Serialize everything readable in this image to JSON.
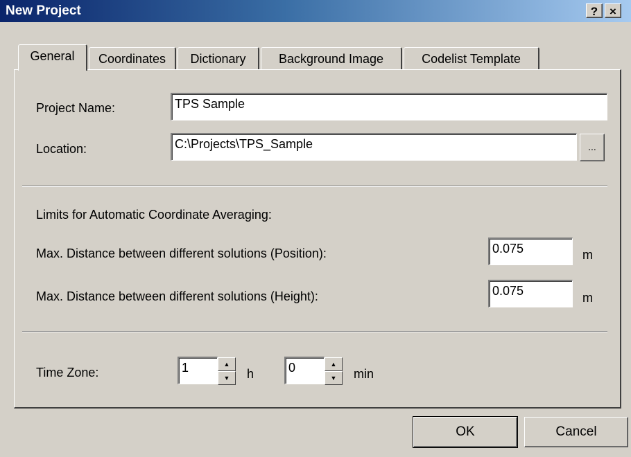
{
  "window": {
    "title": "New Project",
    "help_label": "?",
    "close_label": "×"
  },
  "tabs": [
    {
      "label": "General",
      "active": true
    },
    {
      "label": "Coordinates"
    },
    {
      "label": "Dictionary"
    },
    {
      "label": "Background Image"
    },
    {
      "label": "Codelist Template"
    }
  ],
  "general": {
    "project_name_label": "Project Name:",
    "project_name_value": "TPS Sample",
    "location_label": "Location:",
    "location_value": "C:\\Projects\\TPS_Sample",
    "browse_label": "...",
    "limits_heading": "Limits for Automatic Coordinate Averaging:",
    "max_position_label": "Max. Distance between different solutions (Position):",
    "max_position_value": "0.075",
    "max_position_unit": "m",
    "max_height_label": "Max. Distance between different solutions (Height):",
    "max_height_value": "0.075",
    "max_height_unit": "m",
    "time_zone_label": "Time Zone:",
    "time_zone_hours": "1",
    "hours_unit": "h",
    "time_zone_minutes": "0",
    "minutes_unit": "min"
  },
  "buttons": {
    "ok": "OK",
    "cancel": "Cancel"
  }
}
